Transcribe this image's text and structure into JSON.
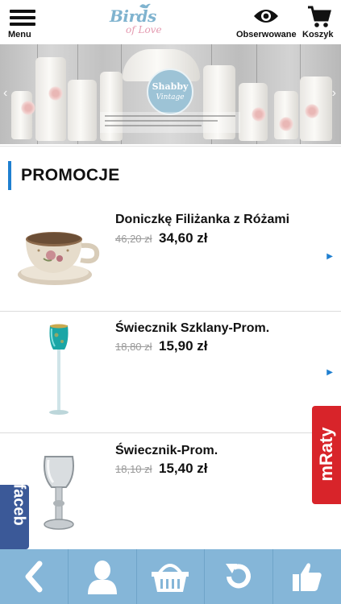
{
  "header": {
    "menu_label": "Menu",
    "logo_word1": "Birds",
    "logo_word2": "of Love",
    "watch_label": "Obserwowane",
    "cart_label": "Koszyk"
  },
  "banner": {
    "badge_line1": "Shabby",
    "badge_line2": "Vintage"
  },
  "section": {
    "title": "PROMOCJE"
  },
  "products": [
    {
      "name": "Doniczkę Filiżanka z Różami",
      "old_price": "46,20 zł",
      "new_price": "34,60 zł",
      "icon": "teacup-planter-icon"
    },
    {
      "name": "Świecznik Szklany-Prom.",
      "old_price": "18,80 zł",
      "new_price": "15,90 zł",
      "icon": "turquoise-glass-candle-holder-icon"
    },
    {
      "name": "Świecznik-Prom.",
      "old_price": "18,10 zł",
      "new_price": "15,40 zł",
      "icon": "clear-glass-candle-holder-icon"
    }
  ],
  "side_tabs": {
    "mraty": "mRaty",
    "facebook": "faceb"
  },
  "bottom_bar": {
    "items": [
      "back-icon",
      "account-icon",
      "basket-icon",
      "refresh-icon",
      "like-icon"
    ]
  },
  "colors": {
    "accent": "#1f7fd0",
    "bottom_bar": "#85b6d8",
    "mraty": "#d8242a",
    "facebook": "#3b5998",
    "logo_blue": "#7fb3cf",
    "logo_pink": "#e49ab0"
  }
}
